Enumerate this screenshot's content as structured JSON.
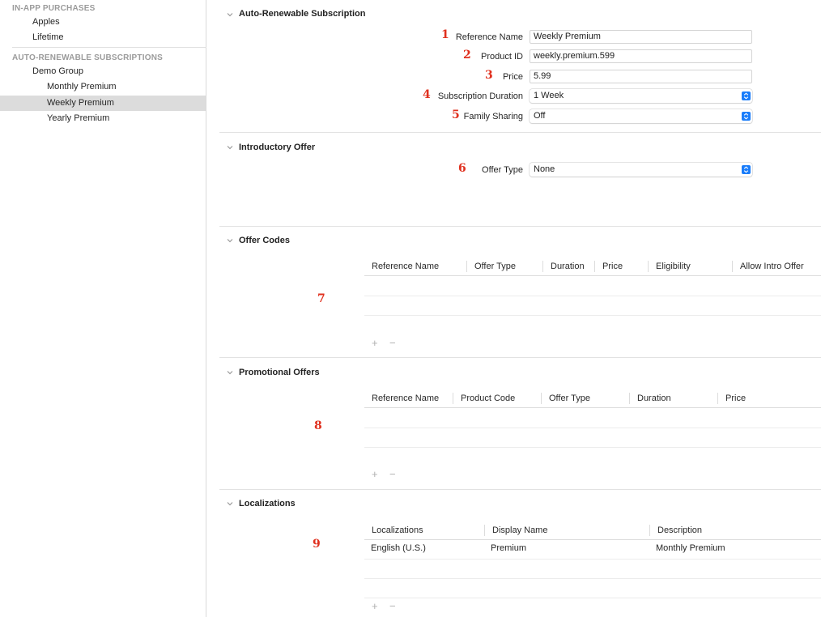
{
  "sidebar": {
    "section_iap": "IN-APP PURCHASES",
    "iap_items": [
      "Apples",
      "Lifetime"
    ],
    "section_ars": "AUTO-RENEWABLE SUBSCRIPTIONS",
    "group": "Demo Group",
    "sub_items": [
      "Monthly Premium",
      "Weekly Premium",
      "Yearly Premium"
    ],
    "selected": "Weekly Premium"
  },
  "auto_renewable": {
    "title": "Auto-Renewable Subscription",
    "reference_name_label": "Reference Name",
    "reference_name_value": "Weekly Premium",
    "product_id_label": "Product ID",
    "product_id_value": "weekly.premium.599",
    "price_label": "Price",
    "price_value": "5.99",
    "duration_label": "Subscription Duration",
    "duration_value": "1 Week",
    "family_label": "Family Sharing",
    "family_value": "Off"
  },
  "intro_offer": {
    "title": "Introductory Offer",
    "offer_type_label": "Offer Type",
    "offer_type_value": "None"
  },
  "offer_codes": {
    "title": "Offer Codes",
    "columns": [
      "Reference Name",
      "Offer Type",
      "Duration",
      "Price",
      "Eligibility",
      "Allow Intro Offer"
    ]
  },
  "promo_offers": {
    "title": "Promotional Offers",
    "columns": [
      "Reference Name",
      "Product Code",
      "Offer Type",
      "Duration",
      "Price"
    ]
  },
  "localizations": {
    "title": "Localizations",
    "columns": [
      "Localizations",
      "Display Name",
      "Description"
    ],
    "rows": [
      {
        "locale": "English (U.S.)",
        "display_name": "Premium",
        "description": "Monthly Premium"
      }
    ]
  },
  "markers": [
    "1",
    "2",
    "3",
    "4",
    "5",
    "6",
    "7",
    "8",
    "9"
  ],
  "controls": {
    "add": "+",
    "remove": "−"
  },
  "colors": {
    "accent": "#1a7dfa",
    "marker": "#e0301e",
    "selection": "#dcdcdc"
  }
}
